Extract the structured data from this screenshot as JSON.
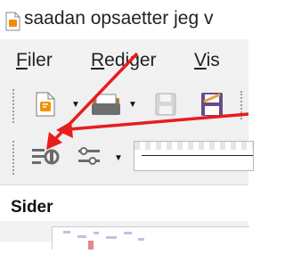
{
  "window": {
    "title": "saadan opsaetter jeg v"
  },
  "menubar": {
    "items": [
      {
        "label": "Filer",
        "underline": "F"
      },
      {
        "label": "Rediger",
        "underline": "R"
      },
      {
        "label": "Vis",
        "underline": "V"
      }
    ]
  },
  "sidebar_panel": {
    "title": "Sider"
  },
  "colors": {
    "annotation_arrow": "#e81d1d",
    "accent_toolbar": "#f0f0f0"
  },
  "icons": [
    "impress-document-icon",
    "new-document-icon",
    "open-folder-icon",
    "save-icon",
    "edit-document-icon",
    "sidebar-settings-icon",
    "line-style-icon"
  ]
}
